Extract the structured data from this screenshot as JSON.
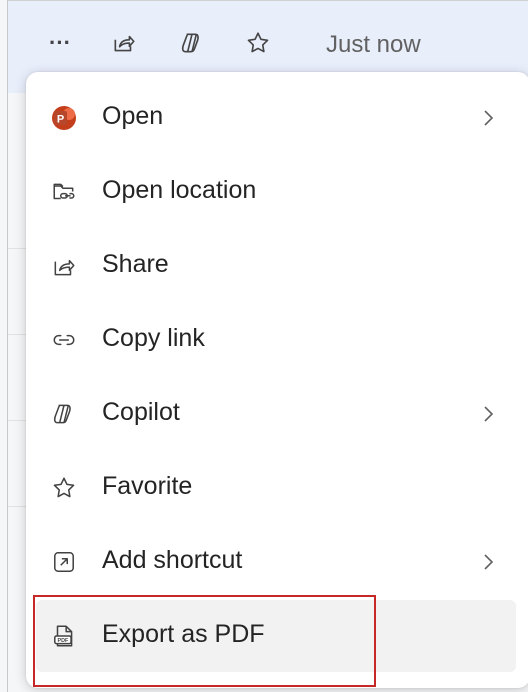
{
  "toolbar": {
    "more_label": "···",
    "timestamp": "Just now"
  },
  "menu": {
    "items": [
      {
        "label": "Open",
        "icon": "powerpoint-icon",
        "submenu": true
      },
      {
        "label": "Open location",
        "icon": "folder-link-icon",
        "submenu": false
      },
      {
        "label": "Share",
        "icon": "share-icon",
        "submenu": false
      },
      {
        "label": "Copy link",
        "icon": "link-icon",
        "submenu": false
      },
      {
        "label": "Copilot",
        "icon": "copilot-icon",
        "submenu": true
      },
      {
        "label": "Favorite",
        "icon": "star-icon",
        "submenu": false
      },
      {
        "label": "Add shortcut",
        "icon": "shortcut-icon",
        "submenu": true
      },
      {
        "label": "Export as PDF",
        "icon": "pdf-icon",
        "submenu": false
      }
    ]
  },
  "colors": {
    "powerpoint_brand": "#c43e1c",
    "highlight_border": "#c62828",
    "toolbar_bg": "#e9eefb"
  }
}
